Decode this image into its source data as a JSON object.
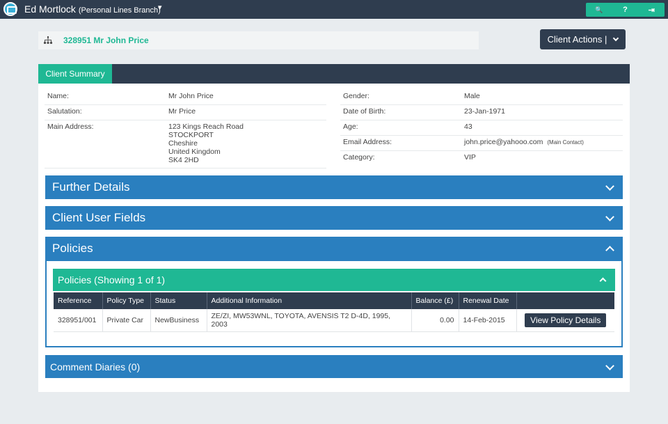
{
  "topbar": {
    "user_name": "Ed Mortlock",
    "branch": "(Personal Lines Branch)",
    "icons": [
      "search-icon",
      "help-icon",
      "logout-icon"
    ],
    "icon_glyphs": [
      "🔍",
      "?",
      "⇥"
    ]
  },
  "client_header": {
    "title": "328951 Mr John Price",
    "actions_label": "Client Actions |",
    "chevron": "⌄"
  },
  "summary": {
    "tab_label": "Client Summary",
    "left": {
      "name_label": "Name:",
      "name_value": "Mr John Price",
      "salutation_label": "Salutation:",
      "salutation_value": "Mr Price",
      "address_label": "Main Address:",
      "address_lines": [
        "123 Kings Reach Road",
        "STOCKPORT",
        "Cheshire",
        "United Kingdom",
        "SK4 2HD"
      ]
    },
    "right": {
      "gender_label": "Gender:",
      "gender_value": "Male",
      "dob_label": "Date of Birth:",
      "dob_value": "23-Jan-1971",
      "age_label": "Age:",
      "age_value": "43",
      "email_label": "Email Address:",
      "email_value": "john.price@yahooo.com",
      "email_note": "(Main Contact)",
      "category_label": "Category:",
      "category_value": "VIP"
    }
  },
  "sections": {
    "further_details": "Further Details",
    "user_fields": "Client User Fields",
    "policies": "Policies",
    "comment_diaries": "Comment Diaries (0)"
  },
  "policies": {
    "subtitle": "Policies (Showing 1 of 1)",
    "columns": [
      "Reference",
      "Policy Type",
      "Status",
      "Additional Information",
      "Balance (£)",
      "Renewal Date",
      ""
    ],
    "rows": [
      {
        "reference": "328951/001",
        "policy_type": "Private Car",
        "status": "NewBusiness",
        "additional_info": "ZE/ZI, MW53WNL, TOYOTA, AVENSIS T2 D-4D, 1995, 2003",
        "balance": "0.00",
        "renewal_date": "14-Feb-2015",
        "action_label": "View Policy Details"
      }
    ]
  },
  "colors": {
    "navbar": "#2f3d4f",
    "accent_green": "#1fb894",
    "section_blue": "#2a7fbf"
  }
}
